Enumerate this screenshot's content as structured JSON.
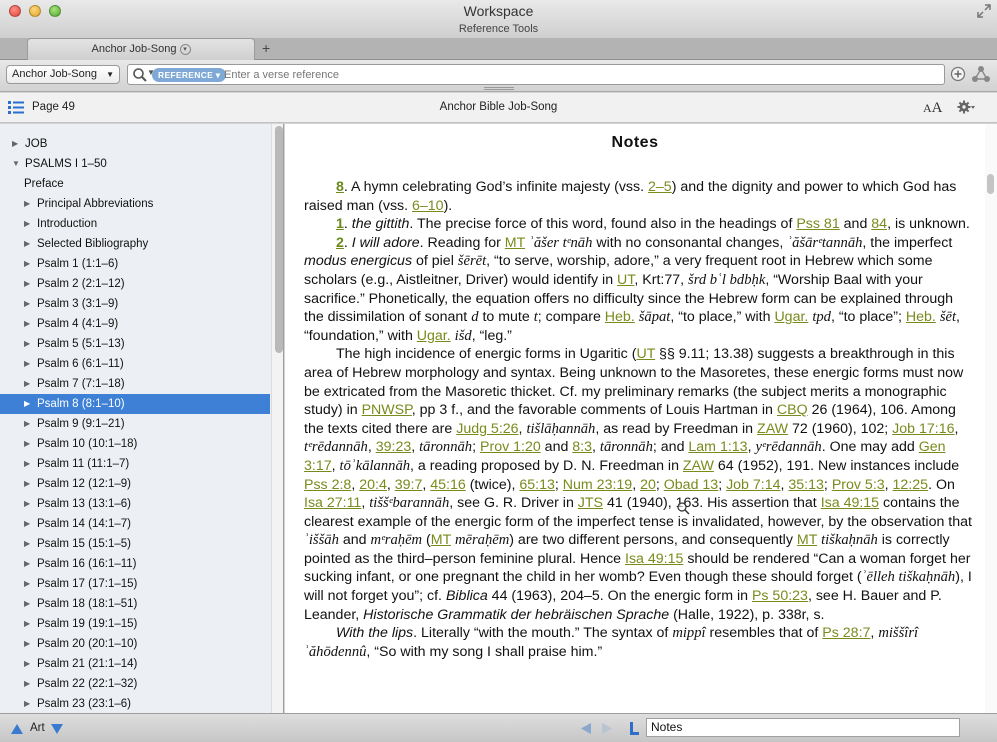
{
  "window": {
    "title": "Workspace",
    "subtitle": "Reference Tools"
  },
  "tabs": {
    "active_tab": "Anchor Job-Song",
    "add_tab": "+"
  },
  "toolbar": {
    "resource": "Anchor Job-Song",
    "reference_pill": "REFERENCE",
    "search_placeholder": "Enter a verse reference"
  },
  "subbar": {
    "page": "Page 49",
    "resource_title": "Anchor Bible Job-Song",
    "font_small": "A",
    "font_big": "A"
  },
  "sidebar": {
    "items": [
      {
        "label": "JOB",
        "level": 0,
        "expanded": false,
        "selected": false,
        "has_children": true
      },
      {
        "label": "PSALMS I 1–50",
        "level": 0,
        "expanded": true,
        "selected": false,
        "has_children": true
      },
      {
        "label": "Preface",
        "level": 1,
        "expanded": false,
        "selected": false,
        "has_children": false
      },
      {
        "label": "Principal Abbreviations",
        "level": 1,
        "expanded": false,
        "selected": false,
        "has_children": true
      },
      {
        "label": "Introduction",
        "level": 1,
        "expanded": false,
        "selected": false,
        "has_children": true
      },
      {
        "label": "Selected Bibliography",
        "level": 1,
        "expanded": false,
        "selected": false,
        "has_children": true
      },
      {
        "label": "Psalm 1 (1:1–6)",
        "level": 1,
        "expanded": false,
        "selected": false,
        "has_children": true
      },
      {
        "label": "Psalm 2 (2:1–12)",
        "level": 1,
        "expanded": false,
        "selected": false,
        "has_children": true
      },
      {
        "label": "Psalm 3 (3:1–9)",
        "level": 1,
        "expanded": false,
        "selected": false,
        "has_children": true
      },
      {
        "label": "Psalm 4 (4:1–9)",
        "level": 1,
        "expanded": false,
        "selected": false,
        "has_children": true
      },
      {
        "label": "Psalm 5 (5:1–13)",
        "level": 1,
        "expanded": false,
        "selected": false,
        "has_children": true
      },
      {
        "label": "Psalm 6 (6:1–11)",
        "level": 1,
        "expanded": false,
        "selected": false,
        "has_children": true
      },
      {
        "label": "Psalm 7 (7:1–18)",
        "level": 1,
        "expanded": false,
        "selected": false,
        "has_children": true
      },
      {
        "label": "Psalm 8 (8:1–10)",
        "level": 1,
        "expanded": false,
        "selected": true,
        "has_children": true
      },
      {
        "label": "Psalm 9 (9:1–21)",
        "level": 1,
        "expanded": false,
        "selected": false,
        "has_children": true
      },
      {
        "label": "Psalm 10 (10:1–18)",
        "level": 1,
        "expanded": false,
        "selected": false,
        "has_children": true
      },
      {
        "label": "Psalm 11 (11:1–7)",
        "level": 1,
        "expanded": false,
        "selected": false,
        "has_children": true
      },
      {
        "label": "Psalm 12 (12:1–9)",
        "level": 1,
        "expanded": false,
        "selected": false,
        "has_children": true
      },
      {
        "label": "Psalm 13 (13:1–6)",
        "level": 1,
        "expanded": false,
        "selected": false,
        "has_children": true
      },
      {
        "label": "Psalm 14 (14:1–7)",
        "level": 1,
        "expanded": false,
        "selected": false,
        "has_children": true
      },
      {
        "label": "Psalm 15 (15:1–5)",
        "level": 1,
        "expanded": false,
        "selected": false,
        "has_children": true
      },
      {
        "label": "Psalm 16 (16:1–11)",
        "level": 1,
        "expanded": false,
        "selected": false,
        "has_children": true
      },
      {
        "label": "Psalm 17 (17:1–15)",
        "level": 1,
        "expanded": false,
        "selected": false,
        "has_children": true
      },
      {
        "label": "Psalm 18 (18:1–51)",
        "level": 1,
        "expanded": false,
        "selected": false,
        "has_children": true
      },
      {
        "label": "Psalm 19 (19:1–15)",
        "level": 1,
        "expanded": false,
        "selected": false,
        "has_children": true
      },
      {
        "label": "Psalm 20 (20:1–10)",
        "level": 1,
        "expanded": false,
        "selected": false,
        "has_children": true
      },
      {
        "label": "Psalm 21 (21:1–14)",
        "level": 1,
        "expanded": false,
        "selected": false,
        "has_children": true
      },
      {
        "label": "Psalm 22 (22:1–32)",
        "level": 1,
        "expanded": false,
        "selected": false,
        "has_children": true
      },
      {
        "label": "Psalm 23 (23:1–6)",
        "level": 1,
        "expanded": false,
        "selected": false,
        "has_children": true
      }
    ]
  },
  "content": {
    "heading": "Notes",
    "paragraphs": [
      [
        {
          "t": "link",
          "v": "8",
          "c": "ref-num"
        },
        {
          "t": "text",
          "v": ". A hymn celebrating God’s infinite majesty (vss. "
        },
        {
          "t": "link",
          "v": "2–5"
        },
        {
          "t": "text",
          "v": ") and the dignity and power to which God has raised man (vss. "
        },
        {
          "t": "link",
          "v": "6–10"
        },
        {
          "t": "text",
          "v": ")."
        }
      ],
      [
        {
          "t": "link",
          "v": "1",
          "c": "ref-num"
        },
        {
          "t": "text",
          "v": ". "
        },
        {
          "t": "em",
          "v": "the gittith"
        },
        {
          "t": "text",
          "v": ". The precise force of this word, found also in the headings of "
        },
        {
          "t": "link",
          "v": "Pss 81"
        },
        {
          "t": "text",
          "v": " and "
        },
        {
          "t": "link",
          "v": "84"
        },
        {
          "t": "text",
          "v": ", is unknown."
        }
      ],
      [
        {
          "t": "link",
          "v": "2",
          "c": "ref-num"
        },
        {
          "t": "text",
          "v": ". "
        },
        {
          "t": "em",
          "v": "I will adore"
        },
        {
          "t": "text",
          "v": ". Reading for "
        },
        {
          "t": "link",
          "v": "MT"
        },
        {
          "t": "text",
          "v": " "
        },
        {
          "t": "tr",
          "v": "ʾăšer tᵉnāh"
        },
        {
          "t": "text",
          "v": " with no consonantal changes, "
        },
        {
          "t": "tr",
          "v": "ʾăšārᵉtannāh"
        },
        {
          "t": "text",
          "v": ", the imperfect "
        },
        {
          "t": "em",
          "v": "modus energicus"
        },
        {
          "t": "text",
          "v": " of piel "
        },
        {
          "t": "tr",
          "v": "šērēt"
        },
        {
          "t": "text",
          "v": ", “to serve, worship, adore,” a very frequent root in Hebrew which some scholars (e.g., Aistleitner, Driver) would identify in "
        },
        {
          "t": "link",
          "v": "UT"
        },
        {
          "t": "text",
          "v": ", Krt:77, "
        },
        {
          "t": "tr",
          "v": "šrd bʿl bdbḥk"
        },
        {
          "t": "text",
          "v": ", “Worship Baal with your sacrifice.” Phonetically, the equation offers no difficulty since the Hebrew form can be explained through the dissimilation of sonant "
        },
        {
          "t": "tr",
          "v": "d"
        },
        {
          "t": "text",
          "v": " to mute "
        },
        {
          "t": "tr",
          "v": "t"
        },
        {
          "t": "text",
          "v": "; compare "
        },
        {
          "t": "link",
          "v": "Heb."
        },
        {
          "t": "text",
          "v": " "
        },
        {
          "t": "tr",
          "v": "šāpat"
        },
        {
          "t": "text",
          "v": ", “to place,” with "
        },
        {
          "t": "link",
          "v": "Ugar."
        },
        {
          "t": "text",
          "v": " "
        },
        {
          "t": "tr",
          "v": "tpd"
        },
        {
          "t": "text",
          "v": ", “to place”; "
        },
        {
          "t": "link",
          "v": "Heb."
        },
        {
          "t": "text",
          "v": " "
        },
        {
          "t": "tr",
          "v": "šēt"
        },
        {
          "t": "text",
          "v": ", “foundation,” with "
        },
        {
          "t": "link",
          "v": "Ugar."
        },
        {
          "t": "text",
          "v": " "
        },
        {
          "t": "tr",
          "v": "išd"
        },
        {
          "t": "text",
          "v": ", “leg.”"
        }
      ],
      [
        {
          "t": "text",
          "v": "The high incidence of energic forms in Ugaritic ("
        },
        {
          "t": "link",
          "v": "UT"
        },
        {
          "t": "text",
          "v": " §§ 9.11; 13.38) suggests a breakthrough in this area of Hebrew morphology and syntax. Being unknown to the Masoretes, these energic forms must now be extricated from the Masoretic thicket. Cf. my preliminary remarks (the subject merits a monographic study) in "
        },
        {
          "t": "link",
          "v": "PNWSP"
        },
        {
          "t": "text",
          "v": ", pp 3 f., and the favorable comments of Louis Hartman in "
        },
        {
          "t": "link",
          "v": "CBQ"
        },
        {
          "t": "text",
          "v": " 26 (1964), 106. Among the texts cited there are "
        },
        {
          "t": "link",
          "v": "Judg 5:26"
        },
        {
          "t": "text",
          "v": ", "
        },
        {
          "t": "tr",
          "v": "tišlāḥannāh"
        },
        {
          "t": "text",
          "v": ", as read by Freedman in "
        },
        {
          "t": "link",
          "v": "ZAW"
        },
        {
          "t": "text",
          "v": " 72 (1960), 102; "
        },
        {
          "t": "link",
          "v": "Job 17:16"
        },
        {
          "t": "text",
          "v": ", "
        },
        {
          "t": "tr",
          "v": "tᵉrēdannāh"
        },
        {
          "t": "text",
          "v": ", "
        },
        {
          "t": "link",
          "v": "39:23"
        },
        {
          "t": "text",
          "v": ", "
        },
        {
          "t": "tr",
          "v": "tāronnāh"
        },
        {
          "t": "text",
          "v": "; "
        },
        {
          "t": "link",
          "v": "Prov 1:20"
        },
        {
          "t": "text",
          "v": " and "
        },
        {
          "t": "link",
          "v": "8:3"
        },
        {
          "t": "text",
          "v": ", "
        },
        {
          "t": "tr",
          "v": "tāronnāh"
        },
        {
          "t": "text",
          "v": "; and "
        },
        {
          "t": "link",
          "v": "Lam 1:13"
        },
        {
          "t": "text",
          "v": ", "
        },
        {
          "t": "tr",
          "v": "yᵉrēdannāh"
        },
        {
          "t": "text",
          "v": ". One may add "
        },
        {
          "t": "link",
          "v": "Gen 3:17"
        },
        {
          "t": "text",
          "v": ", "
        },
        {
          "t": "tr",
          "v": "tōʾkālannāh"
        },
        {
          "t": "text",
          "v": ", a reading proposed by D. N. Freedman in "
        },
        {
          "t": "link",
          "v": "ZAW"
        },
        {
          "t": "text",
          "v": " 64 (1952), 191. New instances include "
        },
        {
          "t": "link",
          "v": "Pss 2:8"
        },
        {
          "t": "text",
          "v": ", "
        },
        {
          "t": "link",
          "v": "20:4"
        },
        {
          "t": "text",
          "v": ", "
        },
        {
          "t": "link",
          "v": "39:7"
        },
        {
          "t": "text",
          "v": ", "
        },
        {
          "t": "link",
          "v": "45:16"
        },
        {
          "t": "text",
          "v": " (twice), "
        },
        {
          "t": "link",
          "v": "65:13"
        },
        {
          "t": "text",
          "v": "; "
        },
        {
          "t": "link",
          "v": "Num 23:19"
        },
        {
          "t": "text",
          "v": ", "
        },
        {
          "t": "link",
          "v": "20"
        },
        {
          "t": "text",
          "v": "; "
        },
        {
          "t": "link",
          "v": "Obad 13"
        },
        {
          "t": "text",
          "v": "; "
        },
        {
          "t": "link",
          "v": "Job 7:14"
        },
        {
          "t": "text",
          "v": ", "
        },
        {
          "t": "link",
          "v": "35:13"
        },
        {
          "t": "text",
          "v": "; "
        },
        {
          "t": "link",
          "v": "Prov 5:3"
        },
        {
          "t": "text",
          "v": ", "
        },
        {
          "t": "link",
          "v": "12:25"
        },
        {
          "t": "text",
          "v": ". On "
        },
        {
          "t": "link",
          "v": "Isa 27:11"
        },
        {
          "t": "text",
          "v": ", "
        },
        {
          "t": "tr",
          "v": "tiššᵉbarannāh"
        },
        {
          "t": "text",
          "v": ", see G. R. Driver in "
        },
        {
          "t": "link",
          "v": "JTS"
        },
        {
          "t": "text",
          "v": " 41 (1940), 163. His assertion that "
        },
        {
          "t": "link",
          "v": "Isa 49:15"
        },
        {
          "t": "text",
          "v": " contains the clearest example of the energic form of the imperfect tense is invalidated, however, by the observation that "
        },
        {
          "t": "tr",
          "v": "ʾiššāh"
        },
        {
          "t": "text",
          "v": " and "
        },
        {
          "t": "tr",
          "v": "mᵉraḥēm"
        },
        {
          "t": "text",
          "v": " ("
        },
        {
          "t": "link",
          "v": "MT"
        },
        {
          "t": "text",
          "v": " "
        },
        {
          "t": "tr",
          "v": "mēraḥēm"
        },
        {
          "t": "text",
          "v": ") are two different persons, and consequently "
        },
        {
          "t": "link",
          "v": "MT"
        },
        {
          "t": "text",
          "v": " "
        },
        {
          "t": "tr",
          "v": "tiškaḥnāh"
        },
        {
          "t": "text",
          "v": " is correctly pointed as the third–person feminine plural. Hence "
        },
        {
          "t": "link",
          "v": "Isa 49:15"
        },
        {
          "t": "text",
          "v": " should be rendered “Can a woman forget her sucking infant, or one pregnant the child in her womb? Even though these should forget ("
        },
        {
          "t": "tr",
          "v": "ʾēlleh tiškaḥnāh"
        },
        {
          "t": "text",
          "v": "), I will not forget you”; cf. "
        },
        {
          "t": "em",
          "v": "Biblica"
        },
        {
          "t": "text",
          "v": " 44 (1963), 204–5. On the energic form in "
        },
        {
          "t": "link",
          "v": "Ps 50:23"
        },
        {
          "t": "text",
          "v": ", see H. Bauer and P. Leander, "
        },
        {
          "t": "em",
          "v": "Historische Grammatik der hebräischen Sprache"
        },
        {
          "t": "text",
          "v": " (Halle, 1922), p. 338r, s."
        }
      ],
      [
        {
          "t": "em",
          "v": "With the lips"
        },
        {
          "t": "text",
          "v": ". Literally “with the mouth.” The syntax of "
        },
        {
          "t": "tr",
          "v": "mippî"
        },
        {
          "t": "text",
          "v": " resembles that of "
        },
        {
          "t": "link",
          "v": "Ps 28:7"
        },
        {
          "t": "text",
          "v": ", "
        },
        {
          "t": "tr",
          "v": "miššîrî ʾăhōdennû"
        },
        {
          "t": "text",
          "v": ", “So with my song I shall praise him.”"
        }
      ]
    ]
  },
  "bottombar": {
    "art_label": "Art",
    "location": "Notes"
  },
  "colors": {
    "selection": "#3d80d6",
    "link": "#7a8a1c",
    "pill": "#7ea9d6"
  }
}
